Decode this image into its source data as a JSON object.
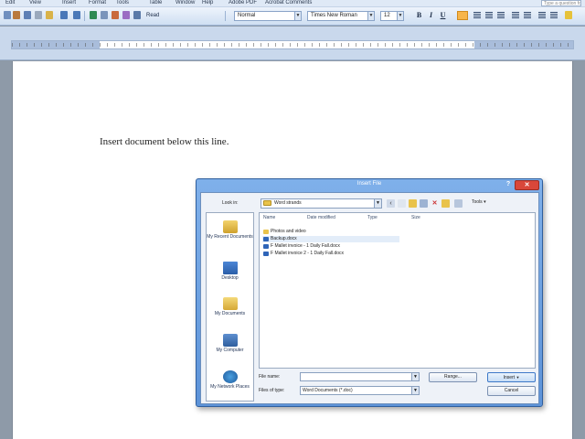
{
  "menubar": {
    "items": [
      "Edit",
      "View",
      "Insert",
      "Format",
      "Tools",
      "Table",
      "Window",
      "Help",
      "Adobe PDF",
      "Acrobat Comments"
    ],
    "help_placeholder": "Type a question for help"
  },
  "toolbar": {
    "read_label": "Read",
    "style": "Normal",
    "font": "Times New Roman",
    "size": "12",
    "bold": "B",
    "italic": "I",
    "underline": "U"
  },
  "document": {
    "text": "Insert document below this line."
  },
  "dialog": {
    "title": "Insert File",
    "help": "?",
    "close": "✕",
    "look_in_label": "Look in:",
    "look_in_value": "Word strands",
    "tools_label": "Tools",
    "places": [
      "My Recent Documents",
      "Desktop",
      "My Documents",
      "My Computer",
      "My Network Places"
    ],
    "columns": [
      "Name",
      "Date modified",
      "Type",
      "Size"
    ],
    "files": [
      "Photos and video",
      "Backup.docx",
      "F Mallet invoice - 1 Daily Fall.docx",
      "F Mallet invoice 2 - 1 Daily Fall.docx"
    ],
    "file_name_label": "File name:",
    "file_name_value": "",
    "files_of_type_label": "Files of type:",
    "files_of_type_value": "Word Documents (*.doc)",
    "range_button": "Range...",
    "insert_button": "Insert",
    "cancel_button": "Cancel"
  },
  "colors": {
    "toolbar_top": "#eef4fc",
    "dialog_frame": "#6b9fe0",
    "close_button": "#d9473a",
    "active_highlight": "#f7b54a"
  }
}
